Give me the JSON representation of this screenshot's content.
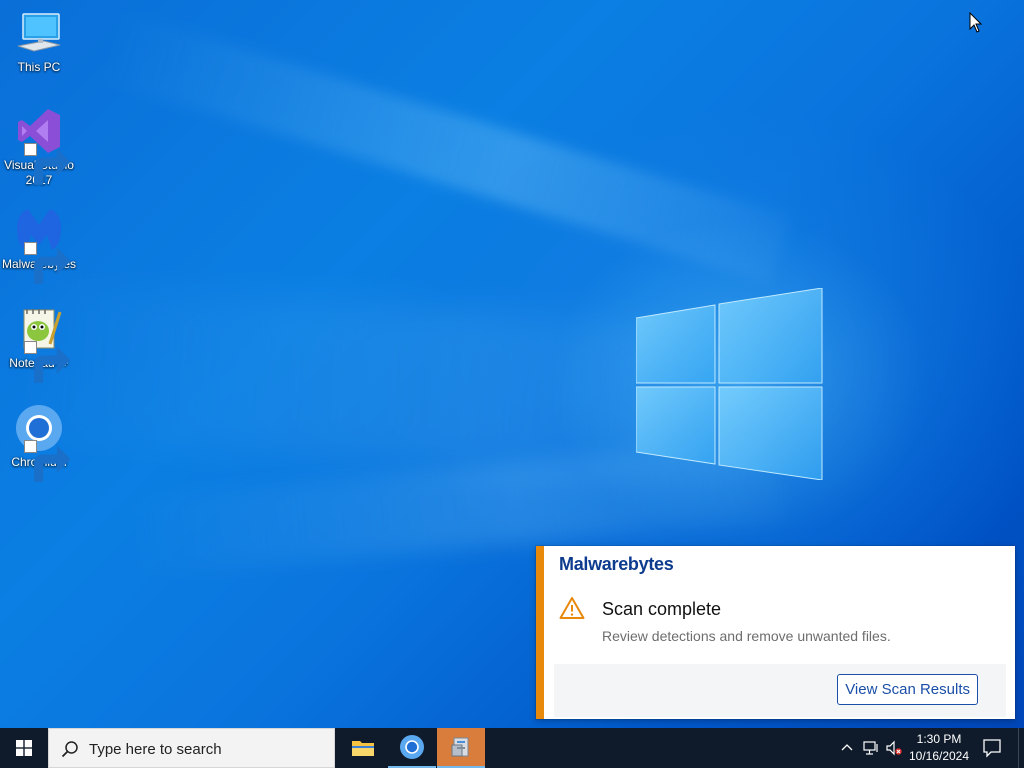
{
  "desktop": {
    "icons": [
      {
        "label": "This PC",
        "icon": "computer-icon"
      },
      {
        "label": "Visual Studio 2017",
        "icon": "visual-studio-icon"
      },
      {
        "label": "Malwarebytes",
        "icon": "malwarebytes-icon"
      },
      {
        "label": "Notepad++",
        "icon": "notepadpp-icon"
      },
      {
        "label": "Chromium",
        "icon": "chromium-icon"
      }
    ]
  },
  "notification": {
    "app_name": "Malwarebytes",
    "title": "Scan complete",
    "body": "Review detections and remove unwanted files.",
    "action_label": "View Scan Results",
    "accent_color": "#e8890c"
  },
  "taskbar": {
    "search_placeholder": "Type here to search",
    "apps": [
      {
        "name": "File Explorer",
        "icon": "folder-icon"
      },
      {
        "name": "Chromium",
        "icon": "chromium-icon"
      },
      {
        "name": "Installer",
        "icon": "installer-icon"
      }
    ],
    "clock": {
      "time": "1:30 PM",
      "date": "10/16/2024"
    }
  },
  "colors": {
    "desktop_blue": "#0a74dd",
    "taskbar": "#0f1b2b",
    "brand_blue": "#0d3b8e"
  }
}
